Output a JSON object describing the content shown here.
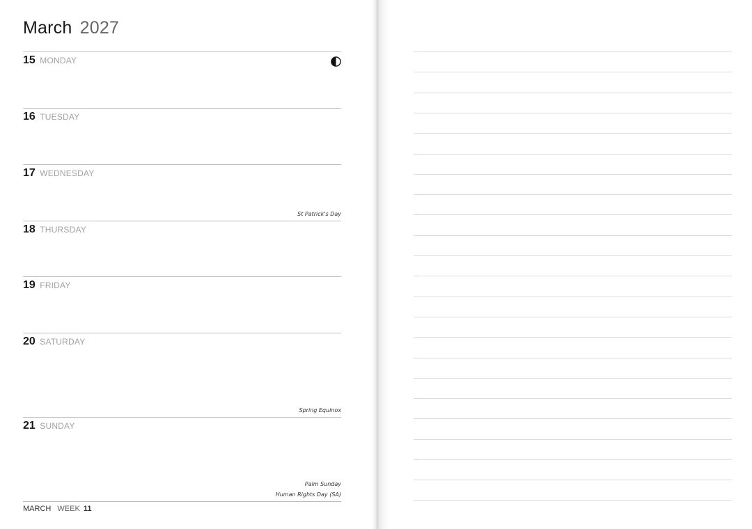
{
  "header": {
    "month": "March",
    "year": "2027"
  },
  "days": [
    {
      "num": "15",
      "name": "MONDAY",
      "moon_icon": "first-quarter-moon-icon",
      "notes": []
    },
    {
      "num": "16",
      "name": "TUESDAY",
      "notes": []
    },
    {
      "num": "17",
      "name": "WEDNESDAY",
      "notes": [
        "St Patrick's Day"
      ]
    },
    {
      "num": "18",
      "name": "THURSDAY",
      "notes": []
    },
    {
      "num": "19",
      "name": "FRIDAY",
      "notes": []
    },
    {
      "num": "20",
      "name": "SATURDAY",
      "notes": [
        "Spring Equinox"
      ]
    },
    {
      "num": "21",
      "name": "SUNDAY",
      "notes": [
        "Palm Sunday",
        "Human Rights Day (SA)"
      ]
    }
  ],
  "footer": {
    "month": "MARCH",
    "week_label": "WEEK",
    "week_num": "11"
  }
}
